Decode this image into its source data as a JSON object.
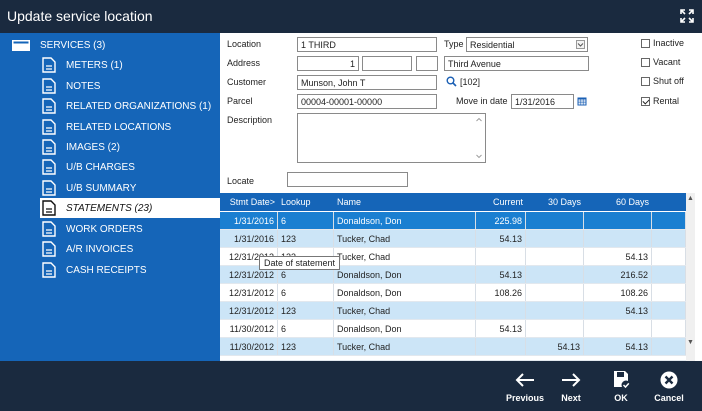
{
  "window": {
    "title": "Update service location"
  },
  "sidebar": {
    "items": [
      {
        "label": "SERVICES (3)"
      },
      {
        "label": "METERS (1)"
      },
      {
        "label": "NOTES"
      },
      {
        "label": "RELATED ORGANIZATIONS (1)"
      },
      {
        "label": "RELATED LOCATIONS"
      },
      {
        "label": "IMAGES (2)"
      },
      {
        "label": "U/B CHARGES"
      },
      {
        "label": "U/B SUMMARY"
      },
      {
        "label": "STATEMENTS (23)"
      },
      {
        "label": "WORK ORDERS"
      },
      {
        "label": "A/R INVOICES"
      },
      {
        "label": "CASH RECEIPTS"
      }
    ],
    "active": "STATEMENTS (23)"
  },
  "form": {
    "location_label": "Location",
    "location_value": "1 THIRD",
    "type_label": "Type",
    "type_value": "Residential",
    "address_label": "Address",
    "address_number": "1",
    "address_street": "Third Avenue",
    "customer_label": "Customer",
    "customer_value": "Munson, John T",
    "customer_link": "[102]",
    "parcel_label": "Parcel",
    "parcel_value": "00004-00001-00000",
    "move_in_label": "Move in date",
    "move_in_value": "1/31/2016",
    "description_label": "Description",
    "locate_label": "Locate",
    "checkboxes": [
      {
        "label": "Inactive",
        "checked": false
      },
      {
        "label": "Vacant",
        "checked": false
      },
      {
        "label": "Shut off",
        "checked": false
      },
      {
        "label": "Rental",
        "checked": true
      }
    ]
  },
  "grid": {
    "columns": [
      "Stmt Date>",
      "Lookup",
      "Name",
      "Current",
      "30 Days",
      "60 Days"
    ],
    "rows": [
      {
        "date": "1/31/2016",
        "lookup": "6",
        "name": "Donaldson, Don",
        "current": "225.98",
        "d30": "",
        "d60": "",
        "style": "sel"
      },
      {
        "date": "1/31/2016",
        "lookup": "123",
        "name": "Tucker, Chad",
        "current": "54.13",
        "d30": "",
        "d60": "",
        "style": "alt"
      },
      {
        "date": "12/31/2012",
        "lookup": "123",
        "name": "Tucker, Chad",
        "current": "",
        "d30": "",
        "d60": "54.13",
        "style": ""
      },
      {
        "date": "12/31/2012",
        "lookup": "6",
        "name": "Donaldson, Don",
        "current": "54.13",
        "d30": "",
        "d60": "216.52",
        "style": "alt"
      },
      {
        "date": "12/31/2012",
        "lookup": "6",
        "name": "Donaldson, Don",
        "current": "108.26",
        "d30": "",
        "d60": "108.26",
        "style": ""
      },
      {
        "date": "12/31/2012",
        "lookup": "123",
        "name": "Tucker, Chad",
        "current": "",
        "d30": "",
        "d60": "54.13",
        "style": "alt"
      },
      {
        "date": "11/30/2012",
        "lookup": "6",
        "name": "Donaldson, Don",
        "current": "54.13",
        "d30": "",
        "d60": "",
        "style": ""
      },
      {
        "date": "11/30/2012",
        "lookup": "123",
        "name": "Tucker, Chad",
        "current": "",
        "d30": "54.13",
        "d60": "54.13",
        "style": "alt"
      }
    ],
    "tooltip": "Date of statement"
  },
  "footer": {
    "previous": "Previous",
    "next": "Next",
    "ok": "OK",
    "cancel": "Cancel"
  },
  "colors": {
    "titlebar": "#1a2a3f",
    "sidebar": "#1565b8",
    "grid_header": "#1565b8",
    "row_selected": "#1a7fd1",
    "row_alt": "#cce5f7",
    "link": "#1a5fb4"
  }
}
